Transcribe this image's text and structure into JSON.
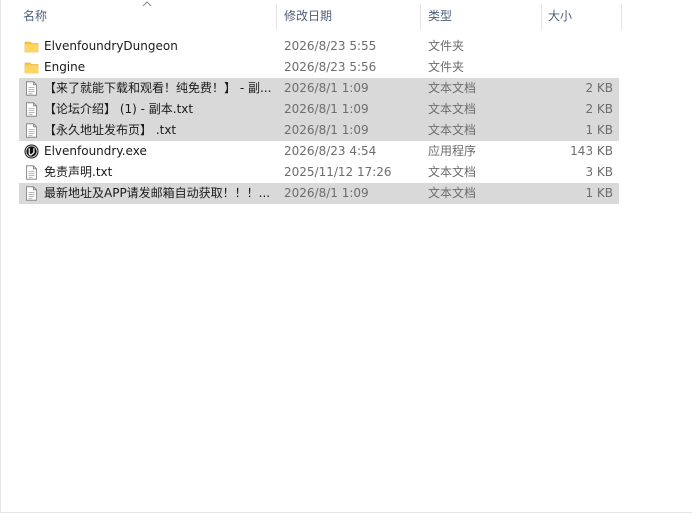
{
  "columns": {
    "name": "名称",
    "modified": "修改日期",
    "type": "类型",
    "size": "大小"
  },
  "files": [
    {
      "name": "ElvenfoundryDungeon",
      "date": "2026/8/23 5:55",
      "type": "文件夹",
      "size": "",
      "icon": "folder-icon",
      "selected": false
    },
    {
      "name": "Engine",
      "date": "2026/8/23 5:56",
      "type": "文件夹",
      "size": "",
      "icon": "folder-icon",
      "selected": false
    },
    {
      "name": "【来了就能下载和观看！纯免费！】 - 副...",
      "date": "2026/8/1 1:09",
      "type": "文本文档",
      "size": "2 KB",
      "icon": "text-file-icon",
      "selected": true
    },
    {
      "name": "【论坛介绍】 (1) - 副本.txt",
      "date": "2026/8/1 1:09",
      "type": "文本文档",
      "size": "2 KB",
      "icon": "text-file-icon",
      "selected": true
    },
    {
      "name": "【永久地址发布页】 .txt",
      "date": "2026/8/1 1:09",
      "type": "文本文档",
      "size": "1 KB",
      "icon": "text-file-icon",
      "selected": true
    },
    {
      "name": "Elvenfoundry.exe",
      "date": "2026/8/23 4:54",
      "type": "应用程序",
      "size": "143 KB",
      "icon": "unreal-app-icon",
      "selected": false
    },
    {
      "name": "免责声明.txt",
      "date": "2025/11/12 17:26",
      "type": "文本文档",
      "size": "3 KB",
      "icon": "text-file-icon",
      "selected": false
    },
    {
      "name": "最新地址及APP请发邮箱自动获取！！！...",
      "date": "2026/8/1 1:09",
      "type": "文本文档",
      "size": "1 KB",
      "icon": "text-file-icon",
      "selected": true
    }
  ],
  "colors": {
    "header_text": "#4c607a",
    "selection": "#d9d9d9",
    "folder": "#f7c948"
  }
}
